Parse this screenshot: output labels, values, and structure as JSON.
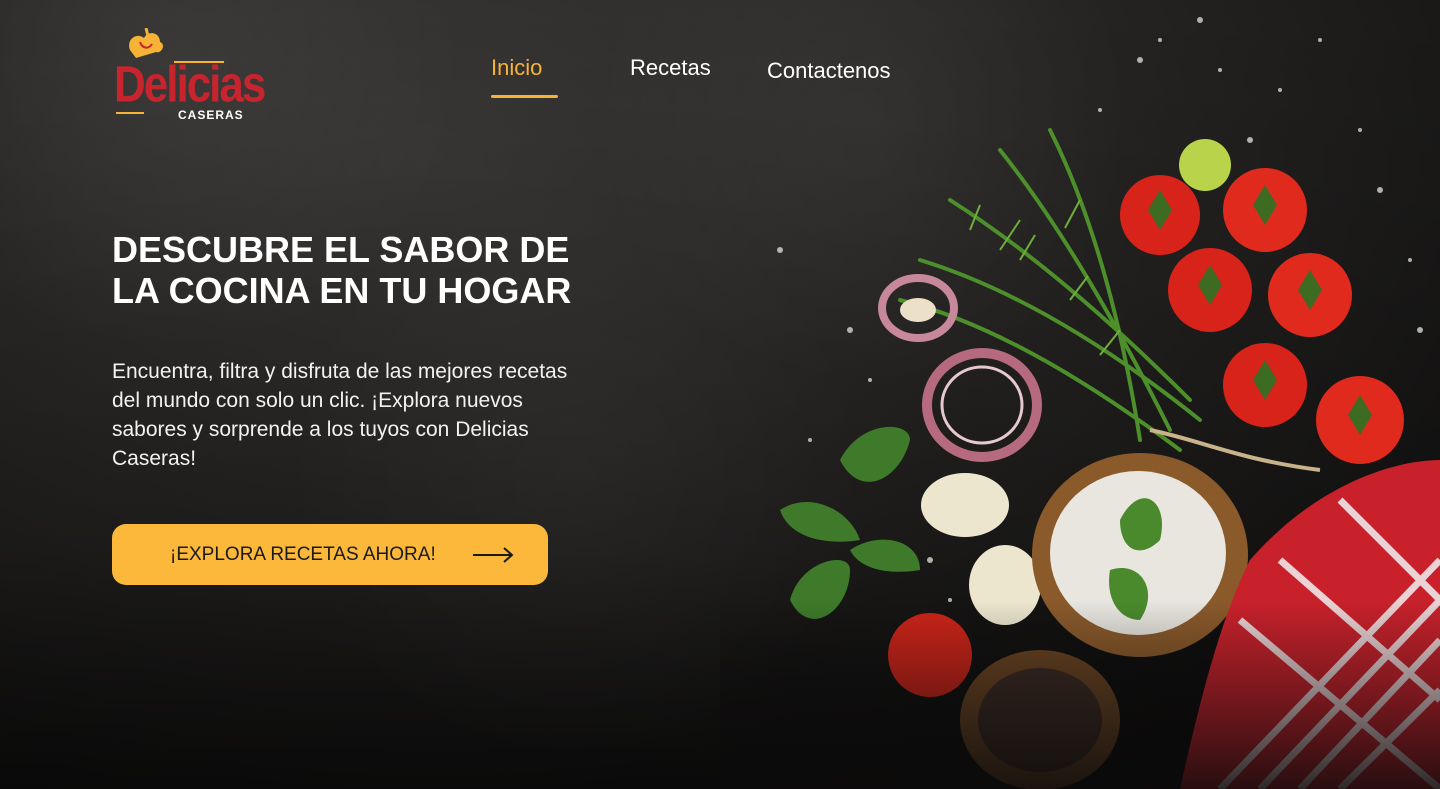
{
  "brand": {
    "name": "Delicias",
    "sub": "CASERAS"
  },
  "nav": {
    "items": [
      {
        "label": "Inicio",
        "active": true
      },
      {
        "label": "Recetas",
        "active": false
      },
      {
        "label": "Contactenos",
        "active": false
      }
    ]
  },
  "hero": {
    "title_line1": "DESCUBRE EL SABOR DE",
    "title_line2": "LA COCINA EN TU HOGAR",
    "description": "Encuentra, filtra y disfruta de las mejores recetas del mundo con solo un clic. ¡Explora nuevos sabores y sorprende a los tuyos con Delicias Caseras!",
    "cta_label": "¡EXPLORA RECETAS AHORA!"
  },
  "colors": {
    "accent": "#fbb83a",
    "brand_red": "#c8242e",
    "background": "#2c2a28"
  },
  "icons": {
    "cta": "arrow-right-icon",
    "logo": "chef-hat-icon"
  }
}
